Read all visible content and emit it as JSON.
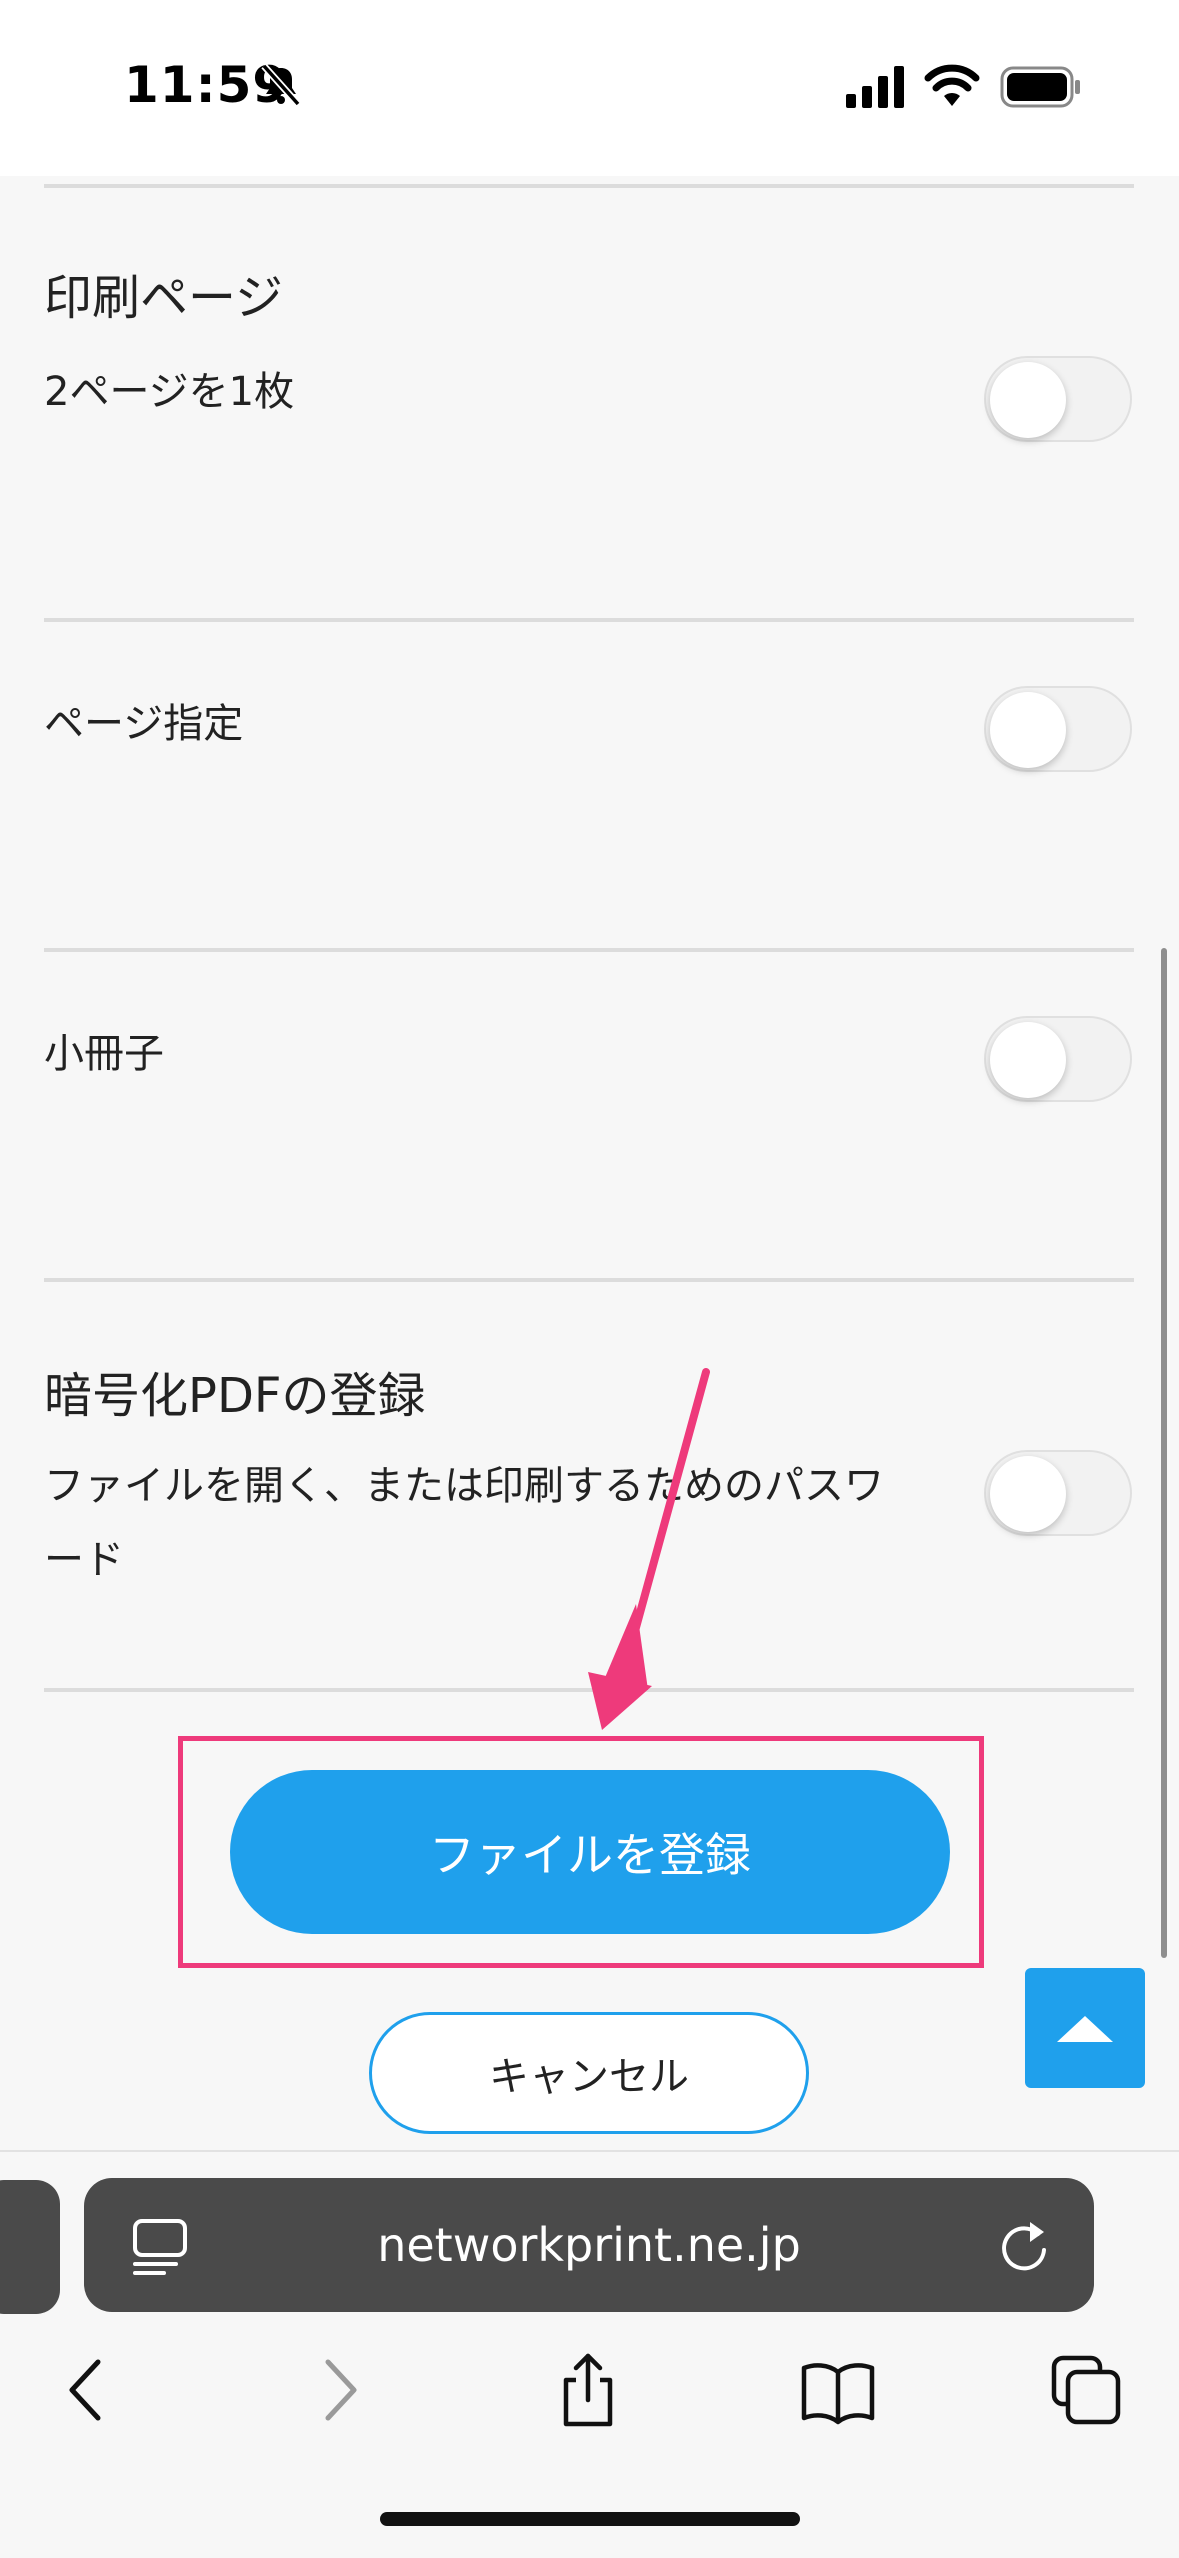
{
  "status_bar": {
    "time": "11:59"
  },
  "settings": {
    "print_pages": {
      "title": "印刷ページ",
      "label": "2ページを1枚",
      "enabled": false
    },
    "page_range": {
      "label": "ページ指定",
      "enabled": false
    },
    "booklet": {
      "label": "小冊子",
      "enabled": false
    },
    "encrypted_pdf": {
      "title": "暗号化PDFの登録",
      "label_line1": "ファイルを開く、または印刷するためのパスワ",
      "label_line2": "ード",
      "enabled": false
    }
  },
  "actions": {
    "register_label": "ファイルを登録",
    "cancel_label": "キャンセル"
  },
  "browser": {
    "url": "networkprint.ne.jp"
  },
  "colors": {
    "accent": "#1fa0ec",
    "annotation": "#ee3a7b"
  }
}
